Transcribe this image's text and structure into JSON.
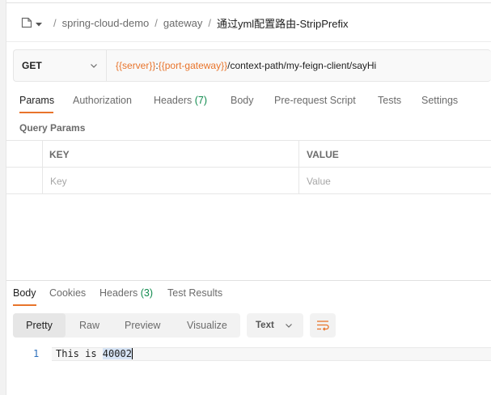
{
  "breadcrumb": {
    "items": [
      "spring-cloud-demo",
      "gateway"
    ],
    "current": "通过yml配置路由-StripPrefix",
    "separator": "/"
  },
  "request": {
    "method": "GET",
    "url_parts": [
      {
        "text": "{{server}}",
        "type": "var"
      },
      {
        "text": ":",
        "type": "plain"
      },
      {
        "text": "{{port-gateway}}",
        "type": "var"
      },
      {
        "text": "/context-path/my-feign-client/sayHi",
        "type": "plain"
      }
    ]
  },
  "request_tabs": {
    "params": "Params",
    "authorization": "Authorization",
    "headers": "Headers",
    "headers_count": "(7)",
    "body": "Body",
    "prerequest": "Pre-request Script",
    "tests": "Tests",
    "settings": "Settings"
  },
  "query_params": {
    "title": "Query Params",
    "columns": [
      "KEY",
      "VALUE"
    ],
    "placeholders": {
      "key": "Key",
      "value": "Value"
    }
  },
  "response_tabs": {
    "body": "Body",
    "cookies": "Cookies",
    "headers": "Headers",
    "headers_count": "(3)",
    "test_results": "Test Results"
  },
  "view_modes": {
    "pretty": "Pretty",
    "raw": "Raw",
    "preview": "Preview",
    "visualize": "Visualize",
    "format": "Text"
  },
  "response_body": {
    "line_number": "1",
    "text_prefix": "This is ",
    "text_highlight": "40002"
  },
  "colors": {
    "accent": "#e8742b",
    "count_green": "#0f8a4d",
    "line_number": "#2c6fbb"
  }
}
